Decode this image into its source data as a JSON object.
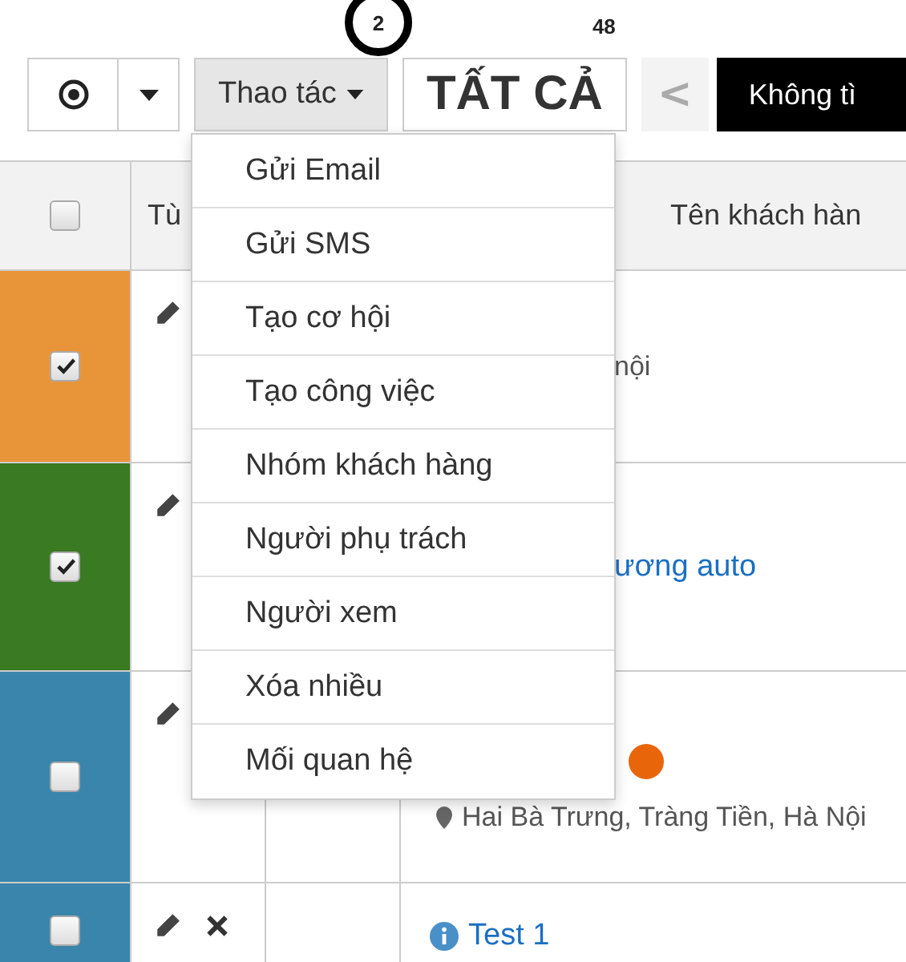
{
  "toolbar": {
    "select_button": {
      "selected": true
    },
    "action_button": {
      "label": "Thao tác",
      "badge": "2",
      "badge_circled": true
    },
    "filter_button": {
      "label": "TẤT CẢ",
      "badge": "48"
    },
    "prev_button": {
      "label": "<"
    },
    "view_button": {
      "label": "Không tì"
    }
  },
  "menu": {
    "items": [
      "Gửi Email",
      "Gửi SMS",
      "Tạo cơ hội",
      "Tạo công việc",
      "Nhóm khách hàng",
      "Người phụ trách",
      "Người xem",
      "Xóa nhiều",
      "Mối quan hệ"
    ]
  },
  "table": {
    "header": {
      "checked": false,
      "columns": [
        "Tù",
        "",
        "Tên khách hàn"
      ]
    },
    "rows": [
      {
        "color": "#e8953a",
        "checked": true,
        "lines": [
          {
            "kind": "address",
            "text": "nội"
          }
        ]
      },
      {
        "color": "#3a7a22",
        "checked": true,
        "lines": [
          {
            "kind": "link",
            "text": "ương auto"
          }
        ]
      },
      {
        "color": "#3a85ab",
        "checked": false,
        "dot": {
          "color": "#e8650a"
        },
        "lines": [
          {
            "kind": "address",
            "text": "Hai Bà Trưng, Tràng Tiền, Hà Nội"
          }
        ]
      },
      {
        "color": "#3a85ab",
        "checked": false,
        "deletable": true,
        "lines": [
          {
            "kind": "info-link",
            "text": "Test 1"
          }
        ]
      }
    ]
  }
}
